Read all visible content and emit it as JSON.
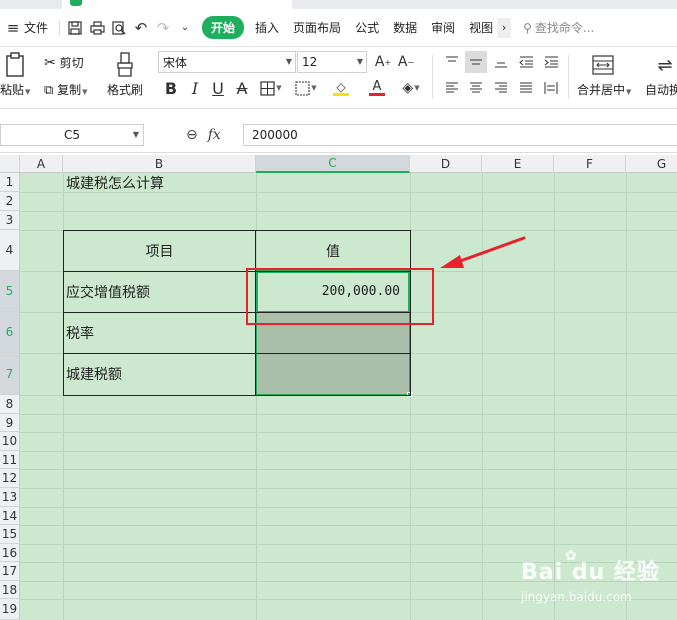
{
  "menu": {
    "file": "文件",
    "tabs": [
      "开始",
      "插入",
      "页面布局",
      "公式",
      "数据",
      "审阅",
      "视图"
    ],
    "active_tab": "开始",
    "search_placeholder": "查找命令..."
  },
  "ribbon": {
    "paste": "粘贴",
    "cut": "剪切",
    "copy": "复制",
    "format_painter": "格式刷",
    "font_name": "宋体",
    "font_size": "12",
    "merge_center": "合并居中",
    "auto_wrap": "自动换"
  },
  "formula_bar": {
    "name_box": "C5",
    "fx": "fx",
    "value": "200000"
  },
  "grid": {
    "columns": [
      "A",
      "B",
      "C",
      "D",
      "E",
      "F",
      "G"
    ],
    "selected_column": "C",
    "rows": [
      "1",
      "2",
      "3",
      "4",
      "5",
      "6",
      "7",
      "8",
      "9",
      "10",
      "11",
      "12",
      "13",
      "14",
      "15",
      "16",
      "17",
      "18",
      "19"
    ],
    "selected_rows": [
      "5",
      "6",
      "7"
    ]
  },
  "sheet": {
    "title": "城建税怎么计算",
    "header_item": "项目",
    "header_value": "值",
    "row5_label": "应交增值税额",
    "row5_value": "200,000.00",
    "row6_label": "税率",
    "row7_label": "城建税额"
  },
  "watermark": {
    "logo": "Bai du 经验",
    "url": "jingyan.baidu.com"
  },
  "colors": {
    "accent": "#1fae5d",
    "sheet_bg": "#cce8cf",
    "annotation": "#e8222a"
  }
}
